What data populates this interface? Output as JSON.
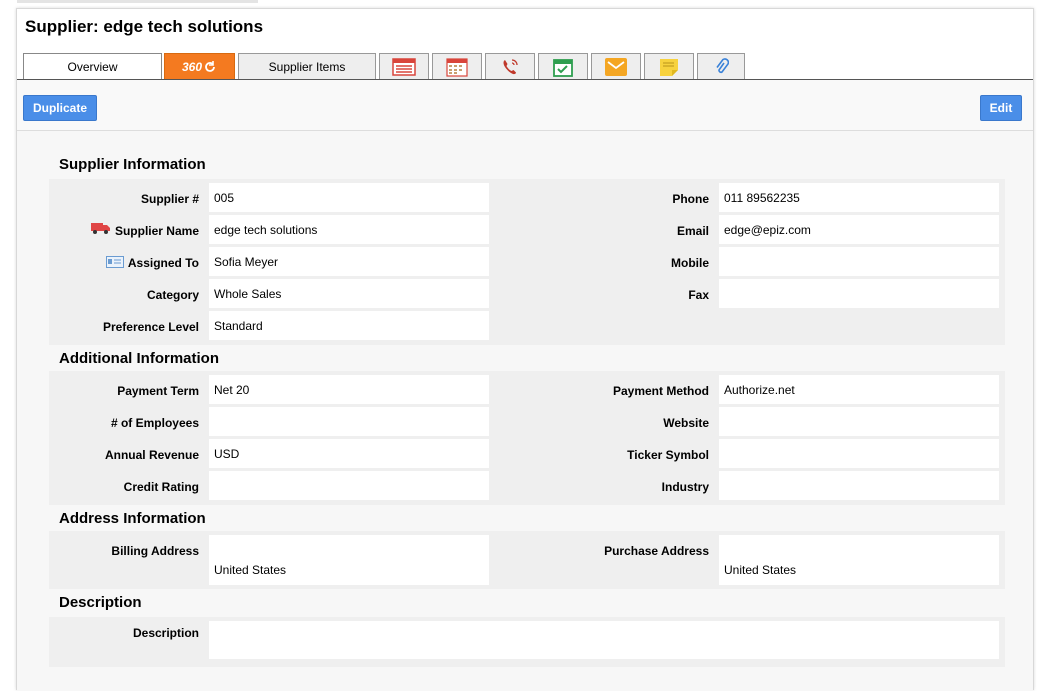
{
  "page": {
    "title": "Supplier: edge tech solutions"
  },
  "tabs": [
    {
      "label": "Overview",
      "icon": ""
    },
    {
      "label": "360",
      "icon": "refresh-icon"
    },
    {
      "label": "Supplier Items",
      "icon": ""
    },
    {
      "label": "",
      "icon": "list-icon"
    },
    {
      "label": "",
      "icon": "calendar-grid-icon"
    },
    {
      "label": "",
      "icon": "phone-icon"
    },
    {
      "label": "",
      "icon": "calendar-check-icon"
    },
    {
      "label": "",
      "icon": "email-icon"
    },
    {
      "label": "",
      "icon": "note-icon"
    },
    {
      "label": "",
      "icon": "attachment-icon"
    }
  ],
  "toolbar": {
    "duplicate_label": "Duplicate",
    "edit_label": "Edit"
  },
  "colors": {
    "primary_button": "#4a8ee8",
    "tab_360": "#f47a20"
  },
  "supplier_info": {
    "title": "Supplier Information",
    "supplier_no_label": "Supplier #",
    "supplier_no": "005",
    "supplier_name_label": "Supplier Name",
    "supplier_name": "edge tech solutions",
    "assigned_to_label": "Assigned To",
    "assigned_to": "Sofia Meyer",
    "category_label": "Category",
    "category": "Whole Sales",
    "preference_label": "Preference Level",
    "preference": "Standard",
    "phone_label": "Phone",
    "phone": "011 89562235",
    "email_label": "Email",
    "email": "edge@epiz.com",
    "mobile_label": "Mobile",
    "mobile": "",
    "fax_label": "Fax",
    "fax": ""
  },
  "additional_info": {
    "title": "Additional Information",
    "payment_term_label": "Payment Term",
    "payment_term": "Net 20",
    "employees_label": "# of Employees",
    "employees": "",
    "annual_revenue_label": "Annual Revenue",
    "annual_revenue": "USD",
    "credit_rating_label": "Credit Rating",
    "credit_rating": "",
    "payment_method_label": "Payment Method",
    "payment_method": "Authorize.net",
    "website_label": "Website",
    "website": "",
    "ticker_label": "Ticker Symbol",
    "ticker": "",
    "industry_label": "Industry",
    "industry": ""
  },
  "address_info": {
    "title": "Address Information",
    "billing_label": "Billing Address",
    "billing_country": "United States",
    "purchase_label": "Purchase Address",
    "purchase_country": "United States"
  },
  "description": {
    "title": "Description",
    "label": "Description",
    "value": ""
  }
}
